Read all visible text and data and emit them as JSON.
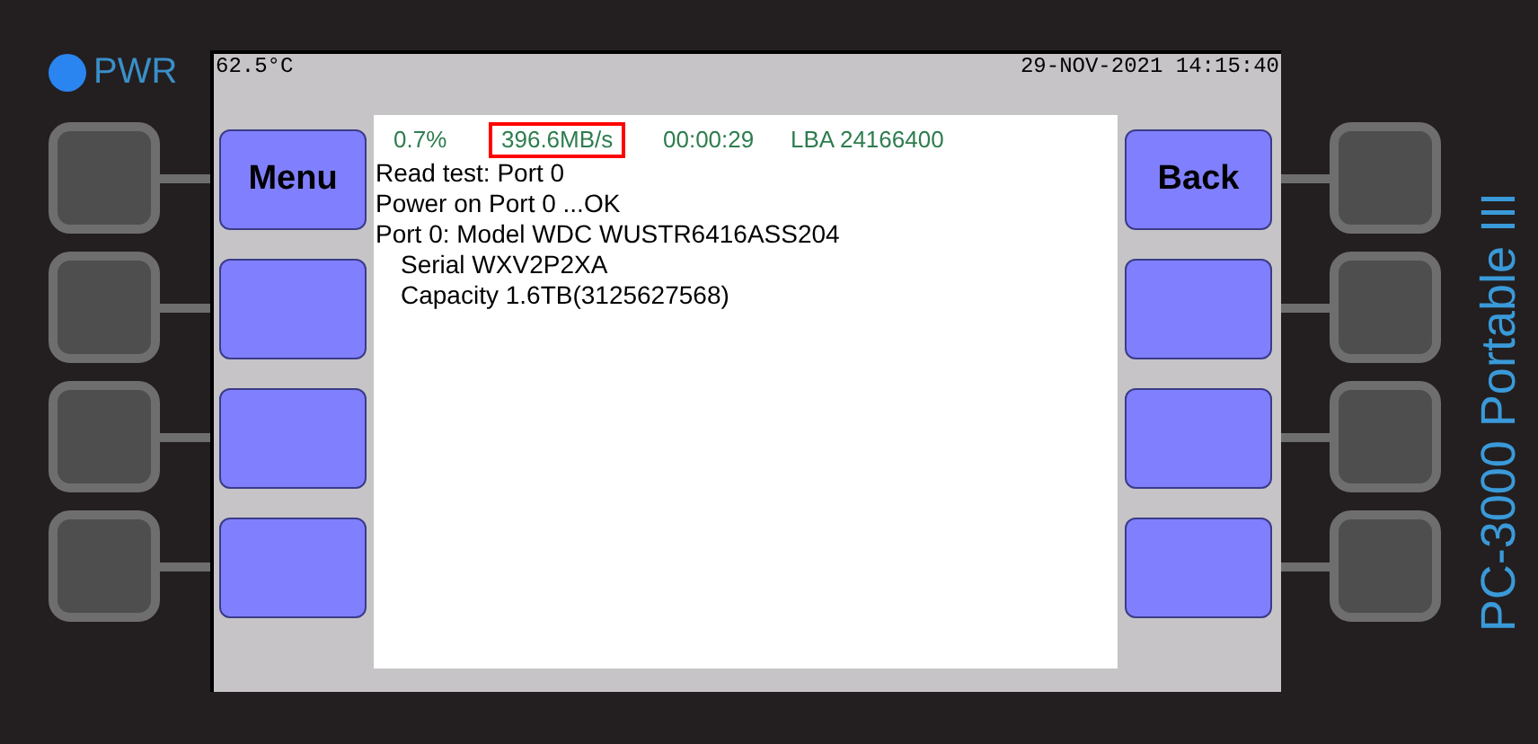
{
  "power": {
    "label": "PWR",
    "on": true
  },
  "brand": "PC-3000 Portable III",
  "screen": {
    "temperature": "62.5°C",
    "datetime": "29-NOV-2021 14:15:40",
    "status": [
      {
        "text": "0.7%",
        "highlighted": false
      },
      {
        "text": "396.6MB/s",
        "highlighted": true
      },
      {
        "text": "00:00:29",
        "highlighted": false
      },
      {
        "text": "LBA 24166400",
        "highlighted": false
      }
    ],
    "log": [
      {
        "text": "Read test: Port 0"
      },
      {
        "text": "Power on Port 0 ...OK"
      },
      {
        "text": "Port 0: Model WDC WUSTR6416ASS204",
        "children": [
          {
            "text": "Serial WXV2P2XA"
          },
          {
            "text": "Capacity 1.6TB(3125627568)"
          }
        ]
      }
    ],
    "left_soft_keys": [
      "Menu"
    ],
    "right_soft_keys": [
      "Back"
    ]
  }
}
